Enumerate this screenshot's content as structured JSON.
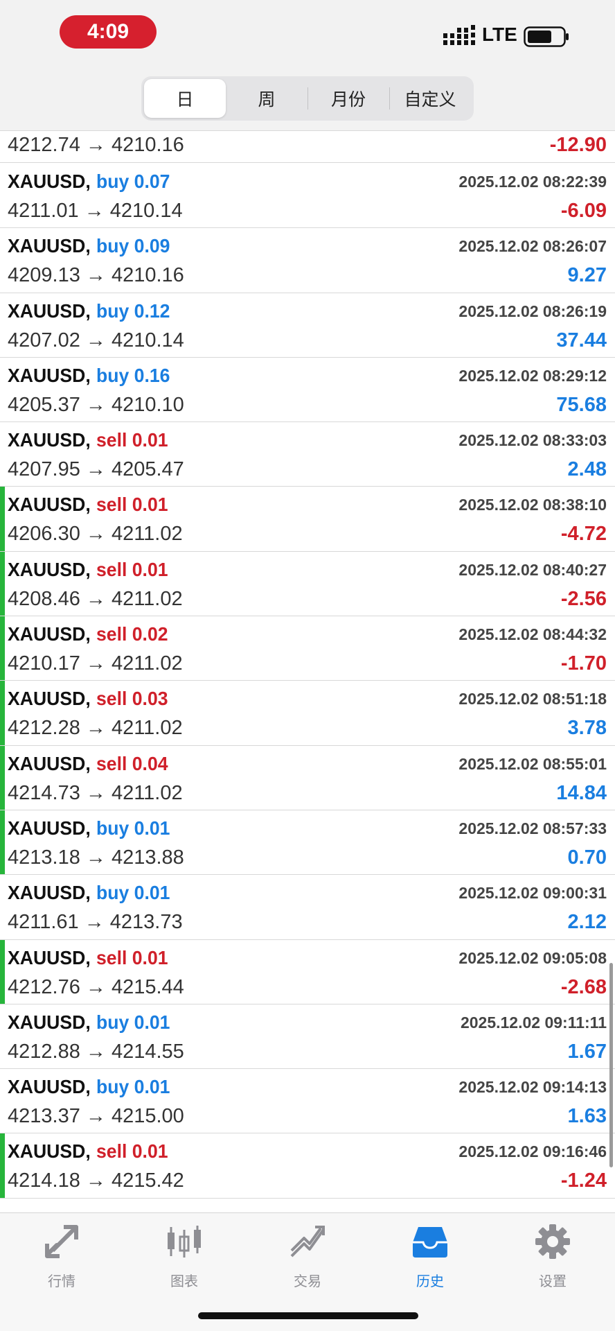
{
  "status_bar": {
    "time": "4:09",
    "network": "LTE"
  },
  "period_tabs": [
    {
      "label": "日",
      "active": true
    },
    {
      "label": "周",
      "active": false
    },
    {
      "label": "月份",
      "active": false
    },
    {
      "label": "自定义",
      "active": false
    }
  ],
  "partial_deal": {
    "prices": "4212.74 → 4210.16",
    "profit": "-12.90"
  },
  "deals": [
    {
      "symbol": "XAUUSD,",
      "side": "buy 0.07",
      "type": "buy",
      "time": "2025.12.02 08:22:39",
      "prices": "4211.01 → 4210.14",
      "profit": "-6.09",
      "marked": false
    },
    {
      "symbol": "XAUUSD,",
      "side": "buy 0.09",
      "type": "buy",
      "time": "2025.12.02 08:26:07",
      "prices": "4209.13 → 4210.16",
      "profit": "9.27",
      "marked": false
    },
    {
      "symbol": "XAUUSD,",
      "side": "buy 0.12",
      "type": "buy",
      "time": "2025.12.02 08:26:19",
      "prices": "4207.02 → 4210.14",
      "profit": "37.44",
      "marked": false
    },
    {
      "symbol": "XAUUSD,",
      "side": "buy 0.16",
      "type": "buy",
      "time": "2025.12.02 08:29:12",
      "prices": "4205.37 → 4210.10",
      "profit": "75.68",
      "marked": false
    },
    {
      "symbol": "XAUUSD,",
      "side": "sell 0.01",
      "type": "sell",
      "time": "2025.12.02 08:33:03",
      "prices": "4207.95 → 4205.47",
      "profit": "2.48",
      "marked": false
    },
    {
      "symbol": "XAUUSD,",
      "side": "sell 0.01",
      "type": "sell",
      "time": "2025.12.02 08:38:10",
      "prices": "4206.30 → 4211.02",
      "profit": "-4.72",
      "marked": true
    },
    {
      "symbol": "XAUUSD,",
      "side": "sell 0.01",
      "type": "sell",
      "time": "2025.12.02 08:40:27",
      "prices": "4208.46 → 4211.02",
      "profit": "-2.56",
      "marked": true
    },
    {
      "symbol": "XAUUSD,",
      "side": "sell 0.02",
      "type": "sell",
      "time": "2025.12.02 08:44:32",
      "prices": "4210.17 → 4211.02",
      "profit": "-1.70",
      "marked": true
    },
    {
      "symbol": "XAUUSD,",
      "side": "sell 0.03",
      "type": "sell",
      "time": "2025.12.02 08:51:18",
      "prices": "4212.28 → 4211.02",
      "profit": "3.78",
      "marked": true
    },
    {
      "symbol": "XAUUSD,",
      "side": "sell 0.04",
      "type": "sell",
      "time": "2025.12.02 08:55:01",
      "prices": "4214.73 → 4211.02",
      "profit": "14.84",
      "marked": true
    },
    {
      "symbol": "XAUUSD,",
      "side": "buy 0.01",
      "type": "buy",
      "time": "2025.12.02 08:57:33",
      "prices": "4213.18 → 4213.88",
      "profit": "0.70",
      "marked": true
    },
    {
      "symbol": "XAUUSD,",
      "side": "buy 0.01",
      "type": "buy",
      "time": "2025.12.02 09:00:31",
      "prices": "4211.61 → 4213.73",
      "profit": "2.12",
      "marked": false
    },
    {
      "symbol": "XAUUSD,",
      "side": "sell 0.01",
      "type": "sell",
      "time": "2025.12.02 09:05:08",
      "prices": "4212.76 → 4215.44",
      "profit": "-2.68",
      "marked": true
    },
    {
      "symbol": "XAUUSD,",
      "side": "buy 0.01",
      "type": "buy",
      "time": "2025.12.02 09:11:11",
      "prices": "4212.88 → 4214.55",
      "profit": "1.67",
      "marked": false
    },
    {
      "symbol": "XAUUSD,",
      "side": "buy 0.01",
      "type": "buy",
      "time": "2025.12.02 09:14:13",
      "prices": "4213.37 → 4215.00",
      "profit": "1.63",
      "marked": false
    },
    {
      "symbol": "XAUUSD,",
      "side": "sell 0.01",
      "type": "sell",
      "time": "2025.12.02 09:16:46",
      "prices": "4214.18 → 4215.42",
      "profit": "-1.24",
      "marked": true
    }
  ],
  "colors": {
    "buy": "#1a7ee0",
    "sell": "#d0202a",
    "marker": "#27b53b",
    "active_tab": "#1a7ee0"
  },
  "tabs": [
    {
      "label": "行情",
      "icon": "quotes-icon",
      "active": false
    },
    {
      "label": "图表",
      "icon": "chart-candles-icon",
      "active": false
    },
    {
      "label": "交易",
      "icon": "trade-icon",
      "active": false
    },
    {
      "label": "历史",
      "icon": "history-inbox-icon",
      "active": true
    },
    {
      "label": "设置",
      "icon": "settings-gear-icon",
      "active": false
    }
  ]
}
